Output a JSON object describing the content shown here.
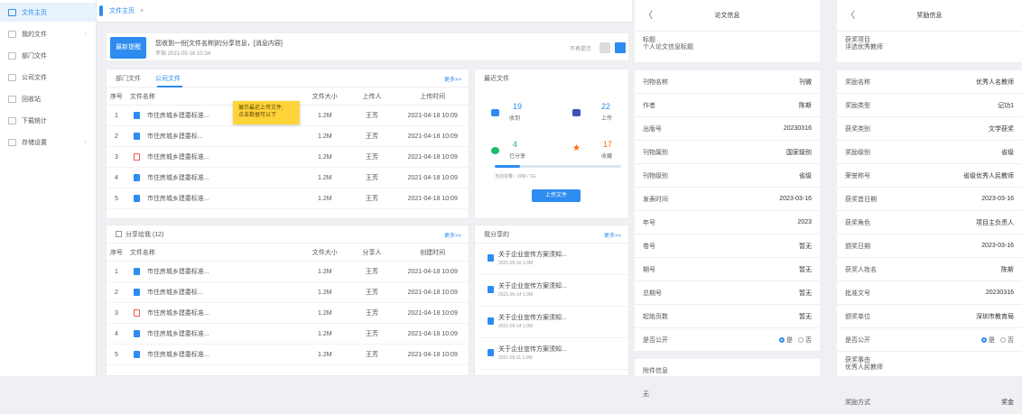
{
  "sidebar": {
    "items": [
      {
        "label": "文件主页",
        "icon": "home-icon",
        "active": true
      },
      {
        "label": "我的文件",
        "icon": "folder-icon",
        "chevron": true
      },
      {
        "label": "部门文件",
        "icon": "department-icon"
      },
      {
        "label": "公司文件",
        "icon": "company-icon"
      },
      {
        "label": "回收站",
        "icon": "trash-icon"
      },
      {
        "label": "下载统计",
        "icon": "chart-icon"
      },
      {
        "label": "存储设置",
        "icon": "settings-icon",
        "chevron": true
      }
    ]
  },
  "tabs": {
    "label": "文件主页",
    "close": "×"
  },
  "notice": {
    "badge": "最新提醒",
    "message": "您收到一份[文件名称]的分享信息，[消息内容]",
    "meta": "李韬   2021-05-16  10:34",
    "noshow": "不再提示"
  },
  "files_panel": {
    "tab_dept": "部门文件",
    "tab_company": "公司文件",
    "more": "更多>>",
    "columns": [
      "序号",
      "文件名称",
      "文件大小",
      "上传人",
      "上传时间"
    ],
    "rows": [
      {
        "no": "1",
        "name": "市住房城乡建委标准...",
        "size": "1.2M",
        "user": "王芳",
        "time": "2021-04-18 10:09",
        "icon": "doc"
      },
      {
        "no": "2",
        "name": "市住房城乡建委标...",
        "size": "1.2M",
        "user": "王芳",
        "time": "2021-04-18 10:09",
        "icon": "doc"
      },
      {
        "no": "3",
        "name": "市住房城乡建委标准...",
        "size": "1.2M",
        "user": "王芳",
        "time": "2021-04-18 10:09",
        "icon": "pdf"
      },
      {
        "no": "4",
        "name": "市住房城乡建委标准...",
        "size": "1.2M",
        "user": "王芳",
        "time": "2021-04-18 10:09",
        "icon": "doc"
      },
      {
        "no": "5",
        "name": "市住房城乡建委标准...",
        "size": "1.2M",
        "user": "王芳",
        "time": "2021-04-18 10:09",
        "icon": "doc"
      }
    ],
    "tooltip": "展示最近上传文件,\n点击数据可以下"
  },
  "shared_panel": {
    "title": "分享给我 (12)",
    "more": "更多>>",
    "columns": [
      "序号",
      "文件名称",
      "文件大小",
      "分享人",
      "创建时间"
    ],
    "rows": [
      {
        "no": "1",
        "name": "市住房城乡建委标准...",
        "size": "1.2M",
        "user": "王芳",
        "time": "2021-04-18 10:09",
        "icon": "doc"
      },
      {
        "no": "2",
        "name": "市住房城乡建委标...",
        "size": "1.2M",
        "user": "王芳",
        "time": "2021-04-18 10:09",
        "icon": "doc"
      },
      {
        "no": "3",
        "name": "市住房城乡建委标准...",
        "size": "1.2M",
        "user": "王芳",
        "time": "2021-04-18 10:09",
        "icon": "pdf"
      },
      {
        "no": "4",
        "name": "市住房城乡建委标准...",
        "size": "1.2M",
        "user": "王芳",
        "time": "2021-04-18 10:09",
        "icon": "doc"
      },
      {
        "no": "5",
        "name": "市住房城乡建委标准...",
        "size": "1.2M",
        "user": "王芳",
        "time": "2021-04-18 10:09",
        "icon": "doc"
      }
    ]
  },
  "recent": {
    "title": "最近文件",
    "stats": [
      {
        "num": "19",
        "label": "收到",
        "icon": "inbox-icon",
        "color": "#2d8cf0"
      },
      {
        "num": "22",
        "label": "上传",
        "icon": "upload-cloud-icon",
        "color": "#3f51b5"
      },
      {
        "num": "4",
        "label": "已分享",
        "icon": "share-icon",
        "color": "#19be6b"
      },
      {
        "num": "17",
        "label": "收藏",
        "icon": "star-icon",
        "color": "#ff6a00"
      }
    ],
    "usage_fraction": 0.2,
    "usage_text": "当前容量：20M / 1G",
    "upload_label": "上传文件"
  },
  "myshare": {
    "title": "我分享的",
    "more": "更多>>",
    "items": [
      {
        "title": "关于企业宣传方案须知...",
        "meta": "2021-05-16   1.0M"
      },
      {
        "title": "关于企业宣传方案须知...",
        "meta": "2021-05-14   1.0M"
      },
      {
        "title": "关于企业宣传方案须知...",
        "meta": "2021-05-14   1.0M"
      },
      {
        "title": "关于企业宣传方案须知...",
        "meta": "2021-05-11   1.0M"
      }
    ]
  },
  "paper": {
    "title": "论文信息",
    "back": "〈",
    "label_title": "标题",
    "value_title": "个人论文信息标题",
    "rows": [
      {
        "k": "刊物名称",
        "v": "刊微"
      },
      {
        "k": "作者",
        "v": "陈斯"
      },
      {
        "k": "出版号",
        "v": "20230316"
      },
      {
        "k": "刊物属别",
        "v": "国家级别"
      },
      {
        "k": "刊物级别",
        "v": "省级"
      },
      {
        "k": "发表时间",
        "v": "2023-03-16"
      },
      {
        "k": "年号",
        "v": "2023"
      },
      {
        "k": "卷号",
        "v": "暂无"
      },
      {
        "k": "期号",
        "v": "暂无"
      },
      {
        "k": "总期号",
        "v": "暂无"
      },
      {
        "k": "起始页数",
        "v": "暂无"
      }
    ],
    "public_label": "是否公开",
    "yes": "是",
    "no": "否",
    "attach_label": "附件信息",
    "attach_value": "无"
  },
  "award": {
    "title": "奖励信息",
    "back": "〈",
    "label_project": "获奖项目",
    "value_project": "评选优秀教师",
    "rows": [
      {
        "k": "奖励名称",
        "v": "优秀人名教师"
      },
      {
        "k": "奖励类型",
        "v": "记功1"
      },
      {
        "k": "获奖类别",
        "v": "文学获奖"
      },
      {
        "k": "奖励级别",
        "v": "省级"
      },
      {
        "k": "荣誉称号",
        "v": "省级优秀人民教师"
      },
      {
        "k": "获奖首日期",
        "v": "2023-03-16"
      },
      {
        "k": "获奖角色",
        "v": "项目主负责人"
      },
      {
        "k": "颁奖日期",
        "v": "2023-03-16"
      },
      {
        "k": "获奖人姓名",
        "v": "陈斯"
      },
      {
        "k": "批准文号",
        "v": "20230316"
      },
      {
        "k": "颁奖单位",
        "v": "深圳市教育局"
      }
    ],
    "public_label": "是否公开",
    "yes": "是",
    "no": "否",
    "label_reason": "获奖事由",
    "value_reason": "优秀人民教师",
    "last_row_k": "奖励方式",
    "last_row_v": "奖金"
  }
}
